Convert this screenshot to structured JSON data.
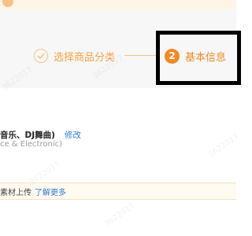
{
  "steps": {
    "done_label": "选择商品分类",
    "current_number": "2",
    "current_label": "基本信息"
  },
  "category": {
    "path": "音乐、DJ舞曲)",
    "modify_label": "修改",
    "english": "ce & Electronic)"
  },
  "notice": {
    "text": "素材上传",
    "link_label": "了解更多"
  },
  "watermark": "3622017",
  "colors": {
    "accent": "#f08a24",
    "accent_light": "#f3c488",
    "link": "#2d7bd5"
  }
}
